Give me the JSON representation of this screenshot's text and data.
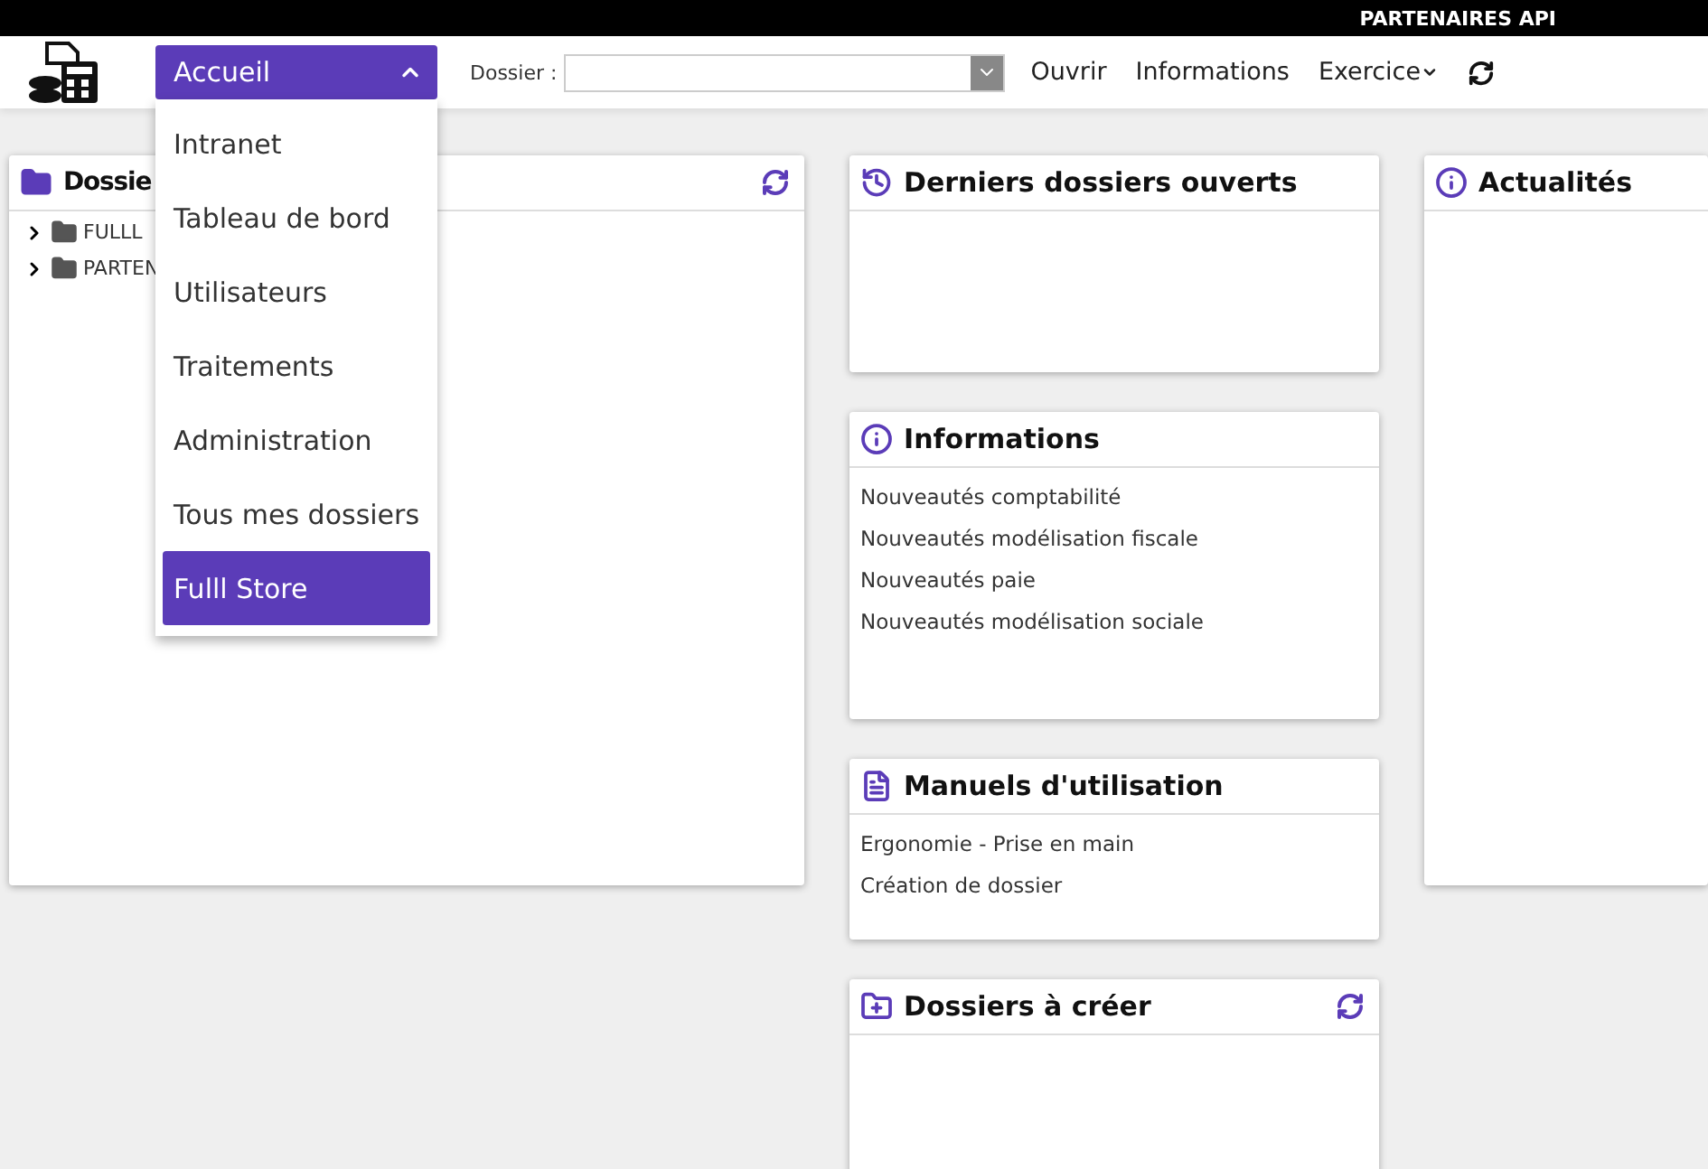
{
  "top_bar": {
    "title": "PARTENAIRES API"
  },
  "header": {
    "menu_button": {
      "label": "Accueil",
      "expanded": true
    },
    "dossier_label": "Dossier :",
    "links": [
      {
        "label": "Ouvrir",
        "kind": "link"
      },
      {
        "label": "Informations",
        "kind": "link"
      },
      {
        "label": "Exercice",
        "kind": "dropdown"
      }
    ]
  },
  "menu": [
    {
      "label": "Intranet",
      "selected": false
    },
    {
      "label": "Tableau de bord",
      "selected": false
    },
    {
      "label": "Utilisateurs",
      "selected": false
    },
    {
      "label": "Traitements",
      "selected": false
    },
    {
      "label": "Administration",
      "selected": false
    },
    {
      "label": "Tous mes dossiers",
      "selected": false
    },
    {
      "label": "Fulll Store",
      "selected": true
    }
  ],
  "dossiers_card": {
    "title": "Dossie",
    "tree": [
      {
        "label": "FULLL",
        "expanded": false
      },
      {
        "label": "PARTEN",
        "expanded": false
      }
    ]
  },
  "middle_cards": [
    {
      "title": "Derniers dossiers ouverts",
      "refresh": false
    },
    {
      "title": "Informations",
      "refresh": false,
      "items": [
        "Nouveautés comptabilité",
        "Nouveautés modélisation fiscale",
        "Nouveautés paie",
        "Nouveautés modélisation sociale"
      ]
    },
    {
      "title": "Manuels d'utilisation",
      "refresh": false,
      "items": [
        "Ergonomie - Prise en main",
        "Création de dossier"
      ]
    },
    {
      "title": "Dossiers à créer",
      "refresh": true
    }
  ],
  "news_card": {
    "title": "Actualités"
  }
}
